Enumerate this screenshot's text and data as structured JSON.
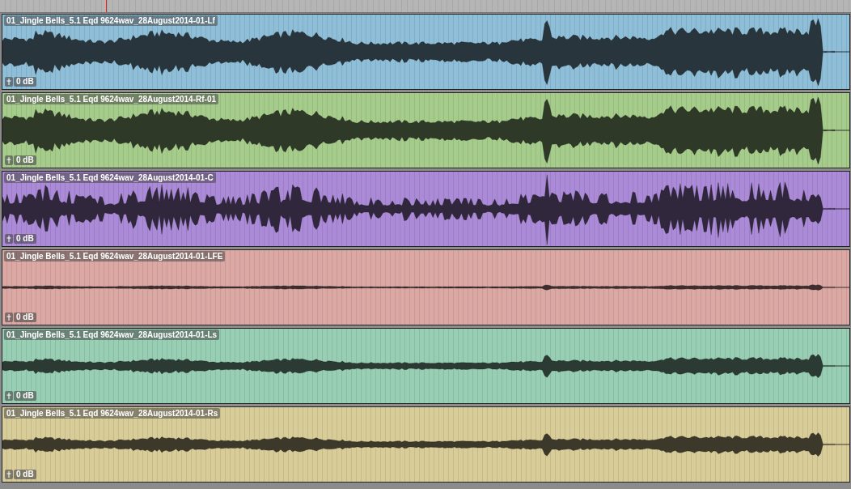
{
  "timeline": {
    "playhead": true
  },
  "clips": [
    {
      "name": "01_Jingle Bells_5.1 Eqd 9624wav_28August2014-01-Lf",
      "gain": "0 dB",
      "color": "#8fbfd8",
      "kind": "loud"
    },
    {
      "name": "01_Jingle Bells_5.1 Eqd 9624wav_28August2014-Rf-01",
      "gain": "0 dB",
      "color": "#a6cc8c",
      "kind": "loud"
    },
    {
      "name": "01_Jingle Bells_5.1 Eqd 9624wav_28August2014-01-C",
      "gain": "0 dB",
      "color": "#ab8ad8",
      "kind": "spiky"
    },
    {
      "name": "01_Jingle Bells_5.1 Eqd 9624wav_28August2014-01-LFE",
      "gain": "0 dB",
      "color": "#dca8a4",
      "kind": "flat"
    },
    {
      "name": "01_Jingle Bells_5.1 Eqd 9624wav_28August2014-01-Ls",
      "gain": "0 dB",
      "color": "#98cfb4",
      "kind": "quiet"
    },
    {
      "name": "01_Jingle Bells_5.1 Eqd 9624wav_28August2014-01-Rs",
      "gain": "0 dB",
      "color": "#d8cc98",
      "kind": "quiet"
    }
  ]
}
